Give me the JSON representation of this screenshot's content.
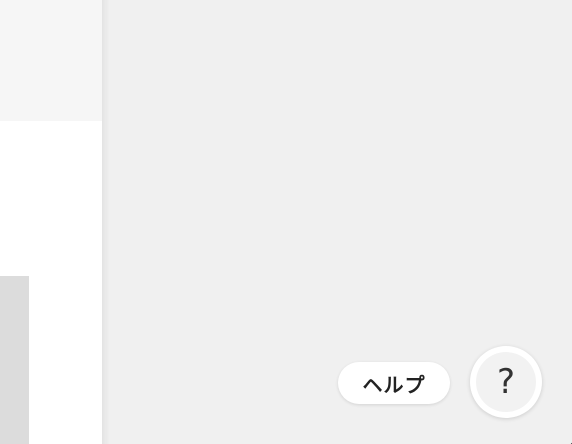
{
  "help": {
    "label": "ヘルプ",
    "button_glyph": "?",
    "icon": "question-mark-icon"
  }
}
